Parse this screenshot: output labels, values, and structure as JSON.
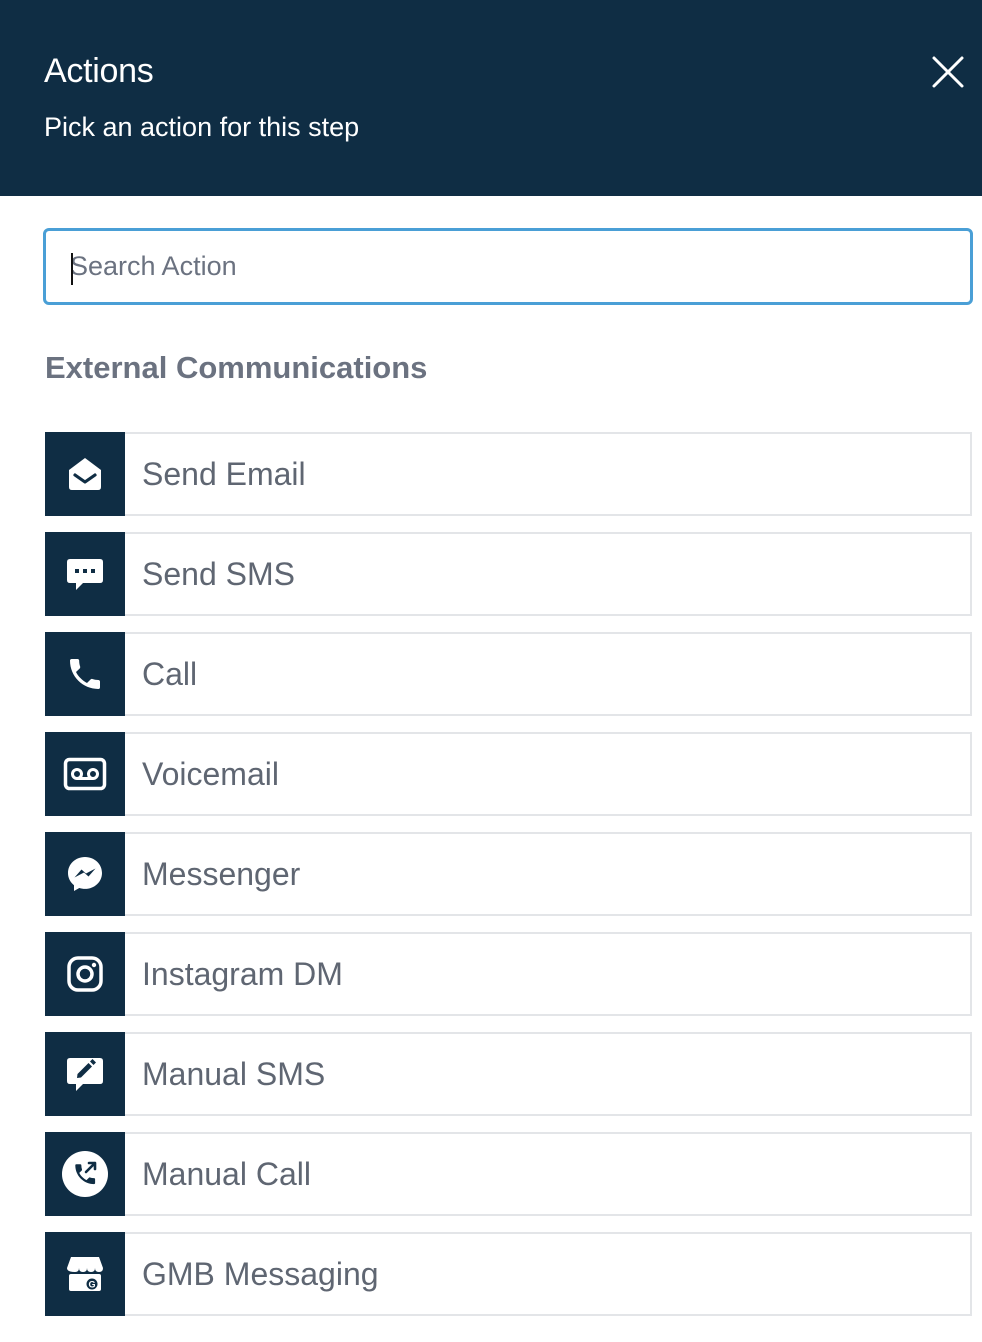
{
  "header": {
    "title": "Actions",
    "subtitle": "Pick an action for this step",
    "close_icon": "close-icon"
  },
  "search": {
    "placeholder": "Search Action",
    "value": ""
  },
  "section": {
    "title": "External Communications"
  },
  "actions": [
    {
      "label": "Send Email",
      "icon": "envelope-open-icon"
    },
    {
      "label": "Send SMS",
      "icon": "chat-bubble-icon"
    },
    {
      "label": "Call",
      "icon": "phone-icon"
    },
    {
      "label": "Voicemail",
      "icon": "voicemail-icon"
    },
    {
      "label": "Messenger",
      "icon": "messenger-icon"
    },
    {
      "label": "Instagram DM",
      "icon": "instagram-icon"
    },
    {
      "label": "Manual SMS",
      "icon": "edit-message-icon"
    },
    {
      "label": "Manual Call",
      "icon": "phone-outgoing-icon"
    },
    {
      "label": "GMB Messaging",
      "icon": "gmb-storefront-icon"
    }
  ],
  "colors": {
    "header_bg": "#0f2d44",
    "accent": "#4a9fd6",
    "label_text": "#5f6672",
    "section_text": "#6b7280",
    "border": "#e3e5e8"
  }
}
